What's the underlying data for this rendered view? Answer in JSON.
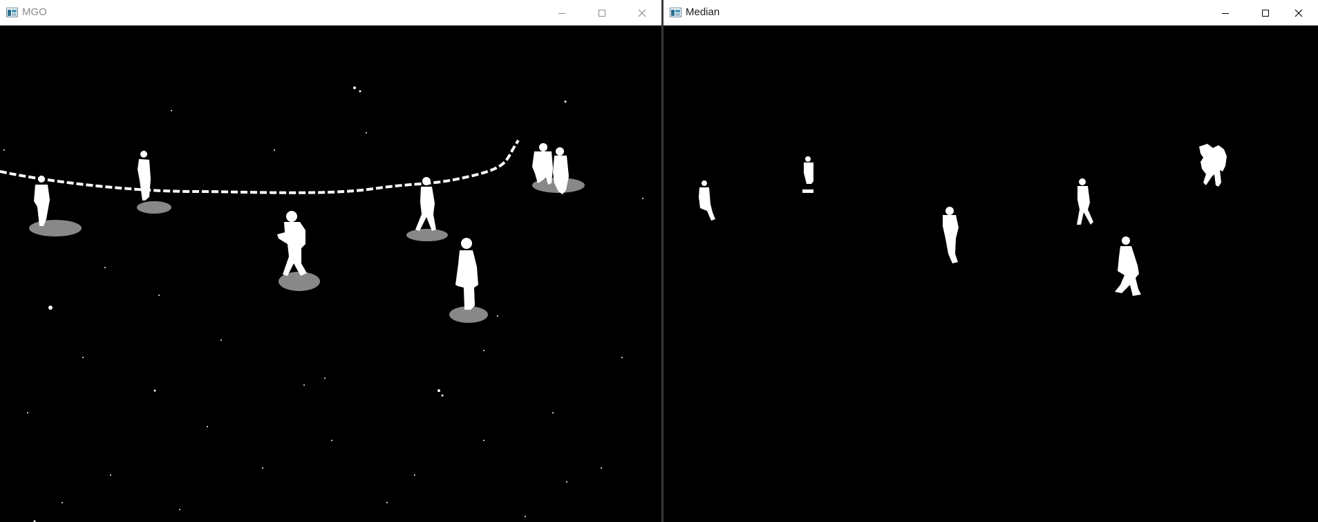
{
  "windows": [
    {
      "title": "MGO",
      "state": "inactive",
      "icon": "opencv-window-icon",
      "controls": [
        "minimize-icon",
        "maximize-icon",
        "close-icon"
      ],
      "content": "foreground-mask-with-shadows"
    },
    {
      "title": "Median",
      "state": "active",
      "icon": "opencv-window-icon",
      "controls": [
        "minimize-icon",
        "maximize-icon",
        "close-icon"
      ],
      "content": "foreground-mask"
    }
  ],
  "colors": {
    "titlebar": "#ffffff",
    "background": "#000000",
    "foreground": "#ffffff",
    "shadow": "#808080",
    "divider": "#3a3a3a"
  }
}
